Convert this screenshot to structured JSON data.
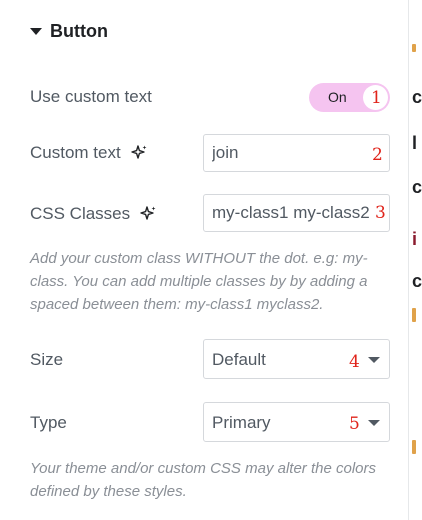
{
  "section": {
    "title": "Button"
  },
  "use_custom_text": {
    "label": "Use custom text",
    "toggle_label": "On",
    "enabled": true
  },
  "custom_text": {
    "label": "Custom text",
    "value": "join"
  },
  "css_classes": {
    "label": "CSS Classes",
    "value": "my-class1 my-class2",
    "help": "Add your custom class WITHOUT the dot. e.g: my-class. You can add multiple classes by by adding a spaced between them: my-class1 myclass2."
  },
  "size": {
    "label": "Size",
    "selected": "Default"
  },
  "type": {
    "label": "Type",
    "selected": "Primary"
  },
  "style_note": "Your theme and/or custom CSS may alter the colors defined by these styles.",
  "markers": [
    "1",
    "2",
    "3",
    "4",
    "5"
  ],
  "colors": {
    "toggle_on": "#f5c4f0",
    "marker": "#e0241b",
    "accent_edge": "#e0a24a"
  },
  "icons": {
    "section_caret": "caret-down-icon",
    "ai_sparkle": "sparkle-icon",
    "select_arrow": "caret-down-icon"
  }
}
